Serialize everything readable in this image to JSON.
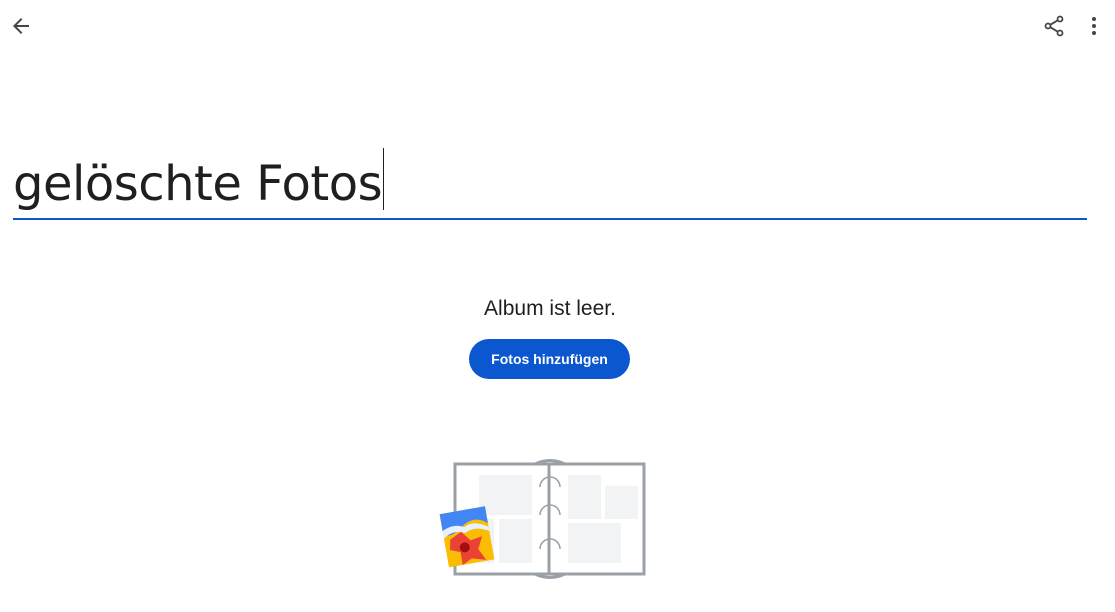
{
  "header": {
    "back_icon": "arrow-back-icon",
    "share_icon": "share-icon",
    "more_icon": "more-vert-icon"
  },
  "album": {
    "title": "gelöschte Fotos"
  },
  "empty_state": {
    "message": "Album ist leer.",
    "add_button_label": "Fotos hinzufügen",
    "illustration_icon": "empty-album-illustration"
  },
  "colors": {
    "accent": "#0b57d0",
    "text": "#1f1f1f",
    "icon": "#444746"
  }
}
